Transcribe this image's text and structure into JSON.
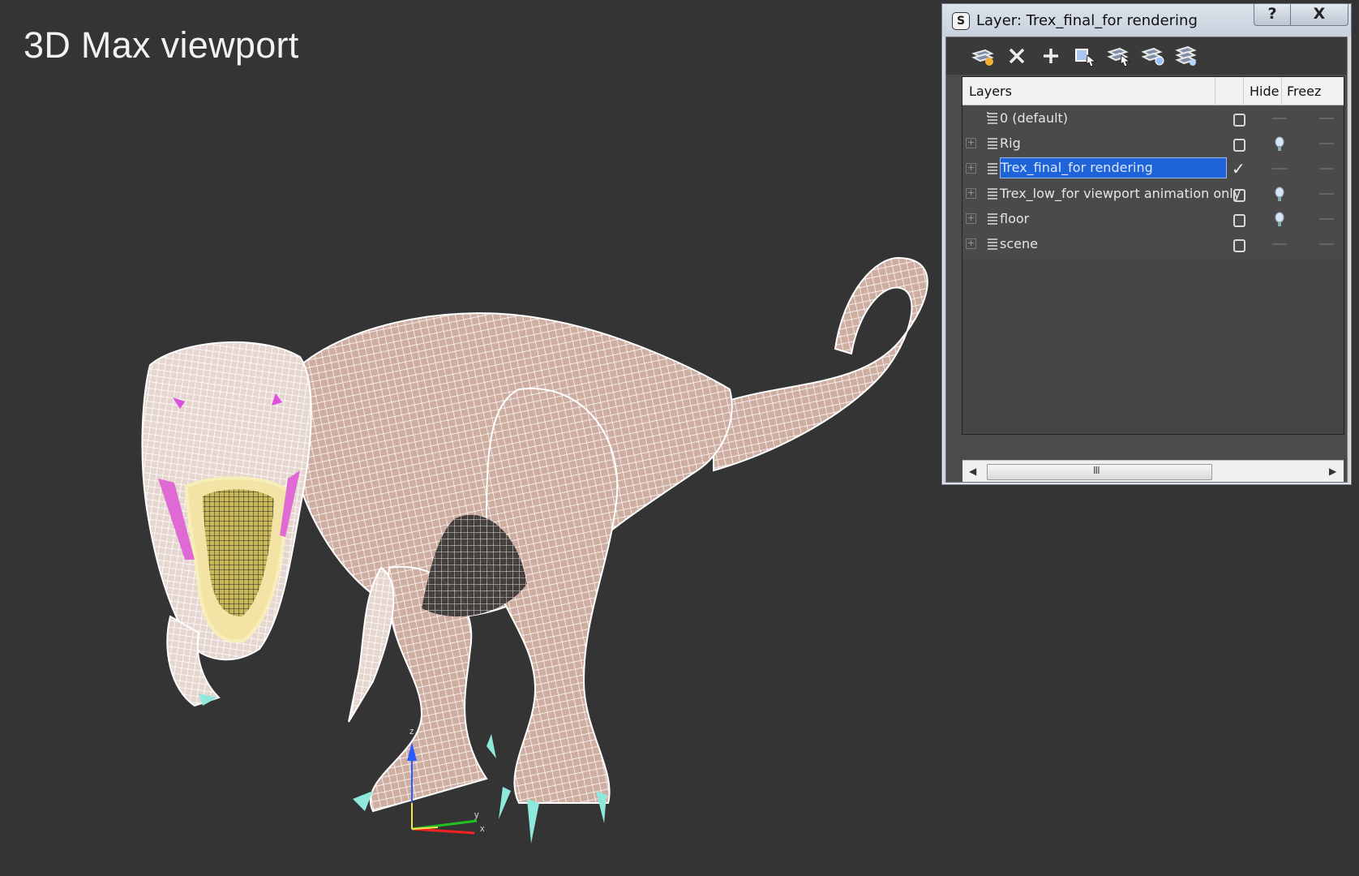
{
  "viewport": {
    "title": "3D Max viewport",
    "background": "#343434",
    "axis_labels": {
      "z": "z",
      "y": "y",
      "x": "x"
    }
  },
  "dialog": {
    "title": "Layer: Trex_final_for rendering",
    "app_icon": "3ds-max-logo-icon",
    "help_label": "?",
    "close_label": "X",
    "toolbar": [
      "create-new-layer-icon",
      "delete-layer-icon",
      "add-selected-to-layer-icon",
      "select-objects-in-layer-icon",
      "set-layer-from-selection-icon",
      "make-current-layer-icon",
      "hide-unhide-all-layers-icon"
    ],
    "columns": {
      "layers": "Layers",
      "hide": "Hide",
      "freeze": "Freez"
    },
    "layers": [
      {
        "name": "0 (default)",
        "expandable": false,
        "current": false,
        "hidden_bulb": false,
        "selected": false
      },
      {
        "name": "Rig",
        "expandable": true,
        "current": false,
        "hidden_bulb": true,
        "selected": false
      },
      {
        "name": "Trex_final_for rendering",
        "expandable": true,
        "current": true,
        "hidden_bulb": false,
        "selected": true
      },
      {
        "name": "Trex_low_for viewport animation only",
        "expandable": true,
        "current": false,
        "hidden_bulb": true,
        "selected": false
      },
      {
        "name": "floor",
        "expandable": true,
        "current": false,
        "hidden_bulb": true,
        "selected": false
      },
      {
        "name": "scene",
        "expandable": true,
        "current": false,
        "hidden_bulb": false,
        "selected": false
      }
    ],
    "scroll_grip": "III",
    "selection_color": "#1f63d8"
  }
}
